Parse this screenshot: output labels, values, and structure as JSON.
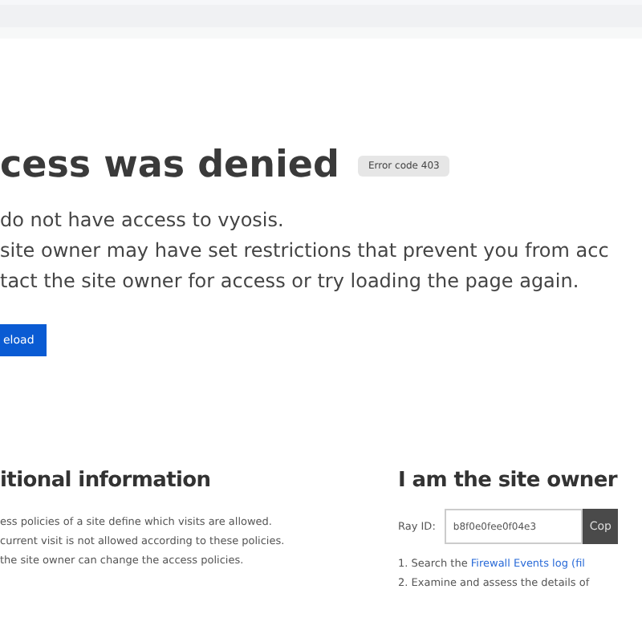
{
  "heading": "cess was denied",
  "badge": "Error code 403",
  "paragraphs": [
    "do not have access to vyosis.",
    "site owner may have set restrictions that prevent you from acc",
    "tact the site owner for access or try loading the page again."
  ],
  "button": "eload",
  "additional": {
    "title": "itional information",
    "lines": [
      "ess policies of a site define which visits are allowed.",
      "current visit is not allowed according to these policies.",
      "the site owner can change the access policies."
    ]
  },
  "owner": {
    "title": "I am the site owner",
    "ray_label": "Ray ID:",
    "ray_value": "b8f0e0fee0f04e3",
    "copy": "Cop",
    "steps": [
      {
        "prefix": "1. Search the ",
        "link": "Firewall Events log (fil"
      },
      {
        "prefix": "2. Examine and assess the details of"
      }
    ]
  }
}
